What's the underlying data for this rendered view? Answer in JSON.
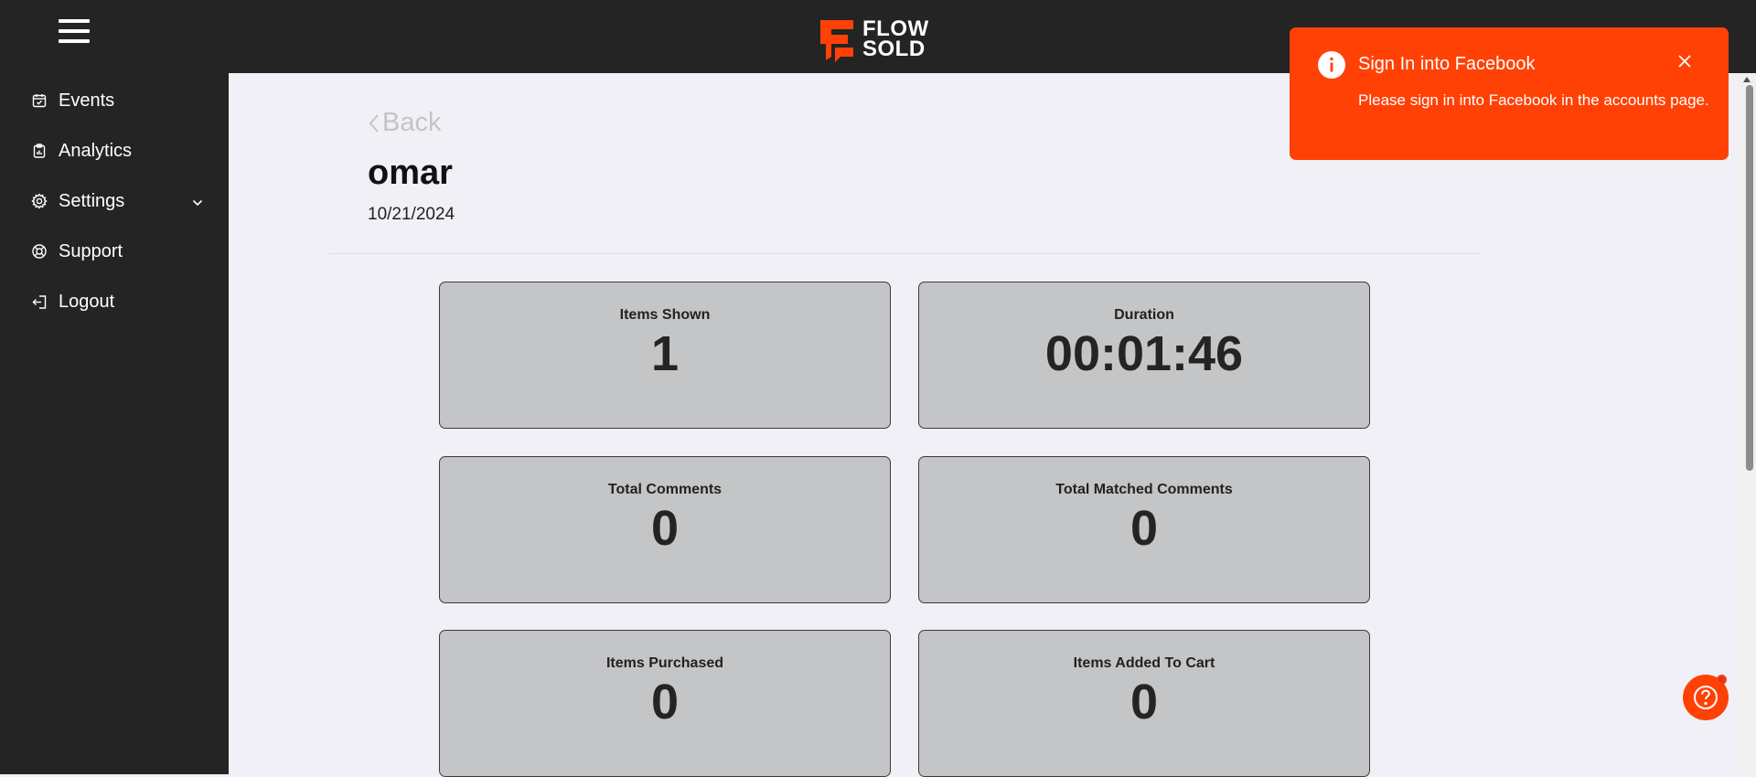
{
  "header": {
    "logo_line1": "FLOW",
    "logo_line2": "SOLD",
    "menu_icon": "hamburger-icon"
  },
  "sidebar": {
    "items": [
      {
        "label": "Events",
        "icon": "calendar-icon"
      },
      {
        "label": "Analytics",
        "icon": "clipboard-chart-icon"
      },
      {
        "label": "Settings",
        "icon": "gear-icon"
      },
      {
        "label": "Support",
        "icon": "lifebuoy-icon"
      },
      {
        "label": "Logout",
        "icon": "logout-icon"
      }
    ]
  },
  "page": {
    "back_label": "Back",
    "title": "omar",
    "date": "10/21/2024"
  },
  "stats": [
    {
      "label": "Items Shown",
      "value": "1"
    },
    {
      "label": "Duration",
      "value": "00:01:46"
    },
    {
      "label": "Total Comments",
      "value": "0"
    },
    {
      "label": "Total Matched Comments",
      "value": "0"
    },
    {
      "label": "Items Purchased",
      "value": "0"
    },
    {
      "label": "Items Added To Cart",
      "value": "0"
    }
  ],
  "toast": {
    "title": "Sign In into Facebook",
    "message": "Please sign in into Facebook in the accounts page.",
    "color": "#ff4106"
  },
  "colors": {
    "brand": "#ff4106",
    "chrome": "#242424",
    "background": "#f0f0f6",
    "card": "#c4c5c7"
  }
}
